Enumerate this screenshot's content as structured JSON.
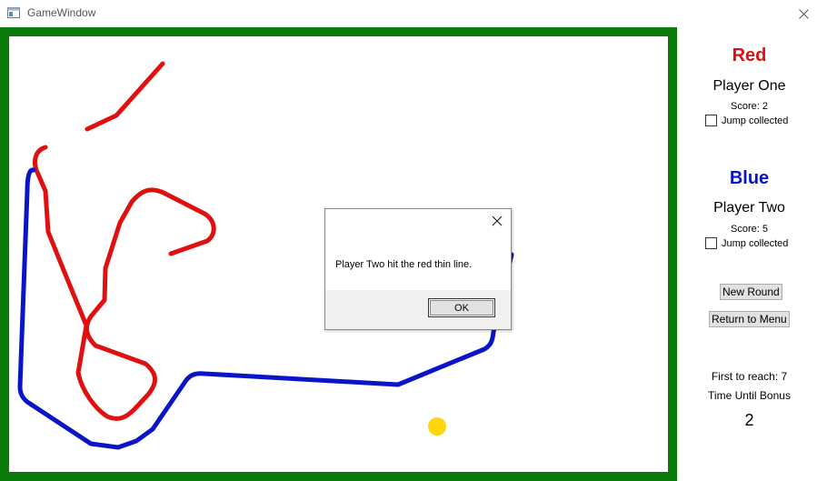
{
  "window": {
    "title": "GameWindow",
    "icon": "window-icon",
    "close_icon": "close-icon"
  },
  "game": {
    "border_color": "#0a7a0a",
    "red_color": "#e01010",
    "blue_color": "#0a14c8",
    "bonus_color": "#ffd60a"
  },
  "players": {
    "red": {
      "name": "Red",
      "label": "Player One",
      "score": "Score: 2",
      "jump": "Jump collected",
      "jump_checked": false
    },
    "blue": {
      "name": "Blue",
      "label": "Player Two",
      "score": "Score: 5",
      "jump": "Jump collected",
      "jump_checked": false
    }
  },
  "buttons": {
    "new_round": "New Round",
    "return_menu": "Return to Menu"
  },
  "info": {
    "first_to_reach": "First to reach: 7",
    "time_until_bonus": "Time Until Bonus",
    "countdown": "2"
  },
  "dialog": {
    "message": "Player Two hit the red thin line.",
    "ok": "OK"
  }
}
